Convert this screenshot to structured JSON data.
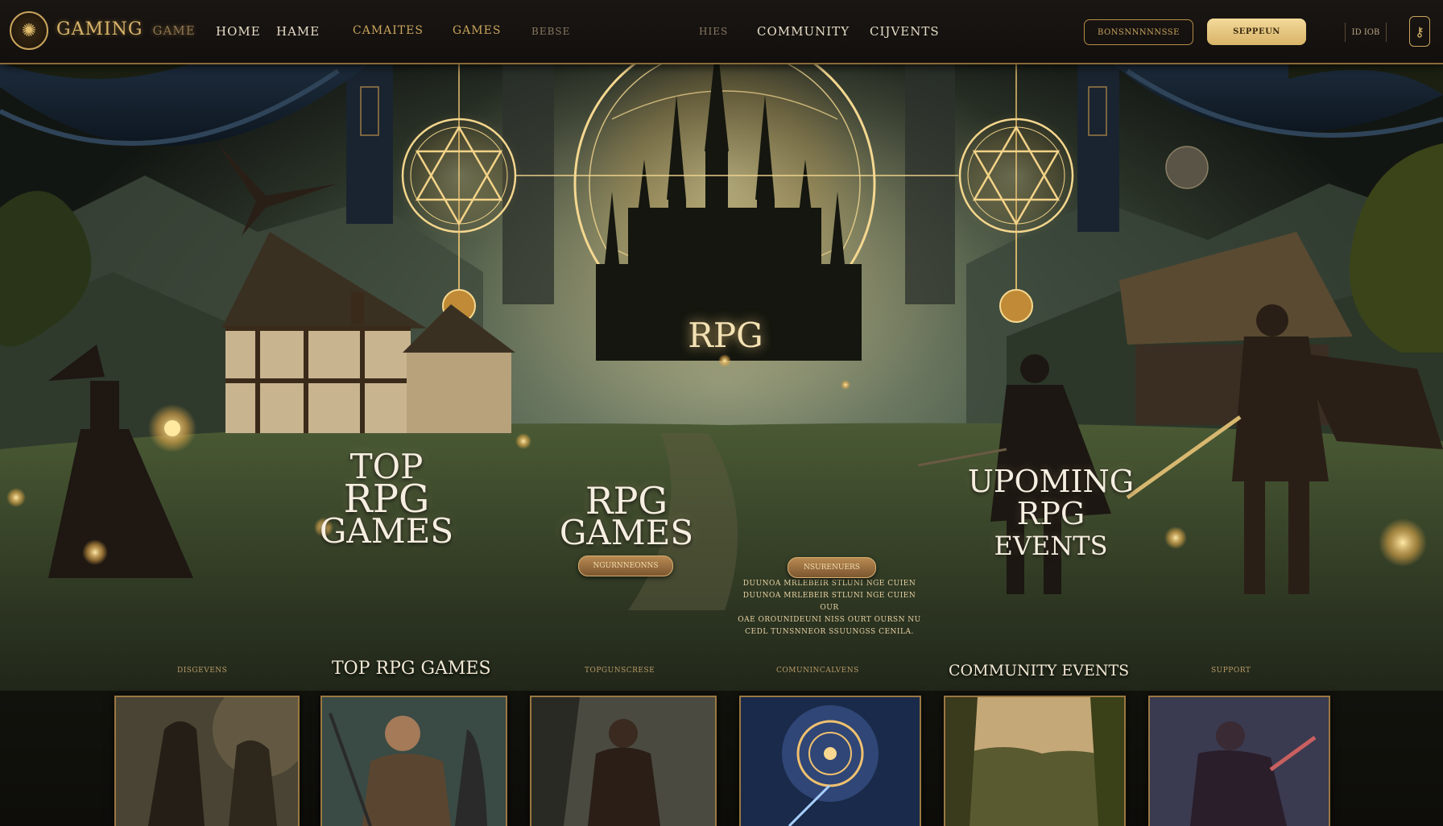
{
  "brand": {
    "name": "GAMING",
    "sub": "GAME",
    "logo_icon": "rune-emblem-icon"
  },
  "nav": {
    "items": [
      "HOME",
      "HAME",
      "CAMAITES",
      "GAMES",
      "BEBSE",
      "HIES",
      "COMMUNITY",
      "CIJVENTS"
    ],
    "outline_button": "BONSNNNNNSSE",
    "solid_button": "SEPPEUN",
    "lang": "ID   IOB",
    "user_icon": "user-key-icon"
  },
  "hero": {
    "center_label": "RPG",
    "left_title": [
      "TOP",
      "RPG",
      "GAMES"
    ],
    "middle_title": [
      "RPG",
      "GAMES"
    ],
    "right_title": [
      "UPOMING",
      "RPG",
      "EVENTS"
    ],
    "middle_text": [
      "DUUNOA MRLEBEIR STLUNI NGE CUIEN",
      "DUUNOA MRLEBEIR STLUNI NGE CUIEN OUR",
      "OAE OROUNIDEUNI NISS OURT OURSN NU",
      "CEDL TUNSNNEOR SSUUNGSS CENILA."
    ],
    "pill_1": "NGURNNEONNS",
    "pill_2": "NSURENUERS"
  },
  "sections": {
    "mini_1": "DISGEVENS",
    "heading_1": "TOP RPG GAMES",
    "mini_2": "TOPGUNSCRESE",
    "mini_3": "COMUNINCALVENS",
    "heading_2": "COMMUNITY EVENTS",
    "mini_4": "SUPPORT"
  },
  "cards": [
    {
      "name": "hooded-ranger",
      "icon": "hooded-figure-icon"
    },
    {
      "name": "armored-knight",
      "icon": "knight-icon"
    },
    {
      "name": "wanderer-swordsman",
      "icon": "swordsman-icon"
    },
    {
      "name": "arcane-sigil",
      "icon": "sigil-icon"
    },
    {
      "name": "misty-valley",
      "icon": "landscape-icon"
    },
    {
      "name": "dark-warrior",
      "icon": "warrior-icon"
    }
  ],
  "colors": {
    "accent_gold": "#c9a45c",
    "nav_bg": "#15120f",
    "glow": "#f5d890",
    "text_light": "#f2e8d4"
  }
}
